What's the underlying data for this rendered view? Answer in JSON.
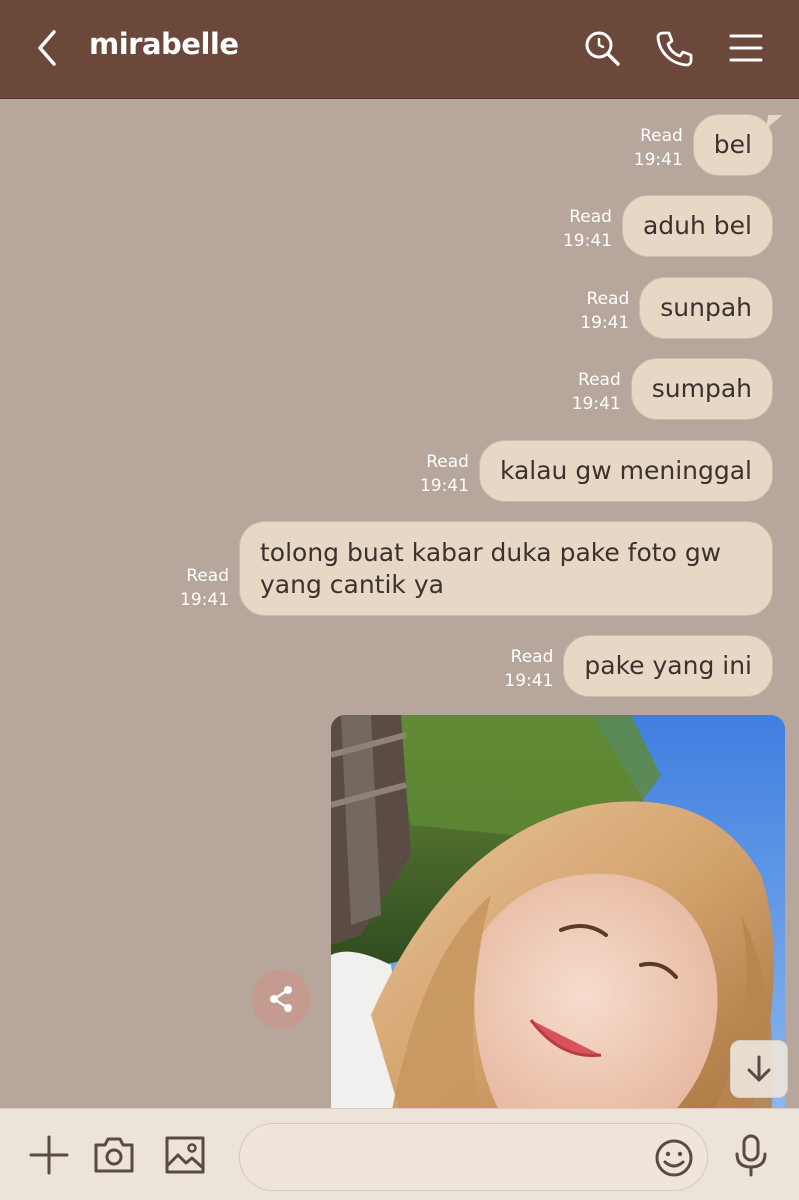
{
  "header": {
    "title": "mirabelle",
    "bg_color": "#6b4839"
  },
  "messages": [
    {
      "text": "bel",
      "status": "Read",
      "time": "19:41"
    },
    {
      "text": "aduh bel",
      "status": "Read",
      "time": "19:41"
    },
    {
      "text": "sunpah",
      "status": "Read",
      "time": "19:41"
    },
    {
      "text": "sumpah",
      "status": "Read",
      "time": "19:41"
    },
    {
      "text": "kalau gw meninggal",
      "status": "Read",
      "time": "19:41"
    },
    {
      "text": "tolong buat kabar duka pake foto gw yang cantik ya",
      "status": "Read",
      "time": "19:41"
    },
    {
      "text": "pake yang ini",
      "status": "Read",
      "time": "19:41"
    }
  ],
  "composer": {
    "value": "",
    "placeholder": ""
  },
  "colors": {
    "chat_background": "#b7a69b",
    "bubble": "#e7d8c6",
    "bubble_text": "#3c322d",
    "meta_text": "#ffffff",
    "bottom_bar": "#ece3d9",
    "share_button": "#c49c8f"
  },
  "icons": {
    "back": "chevron-left-icon",
    "search": "search-icon",
    "call": "phone-icon",
    "menu": "menu-icon",
    "share": "share-icon",
    "scroll": "arrow-down-icon",
    "plus": "plus-icon",
    "camera": "camera-icon",
    "gallery": "image-icon",
    "emoji": "emoji-icon",
    "mic": "microphone-icon"
  }
}
